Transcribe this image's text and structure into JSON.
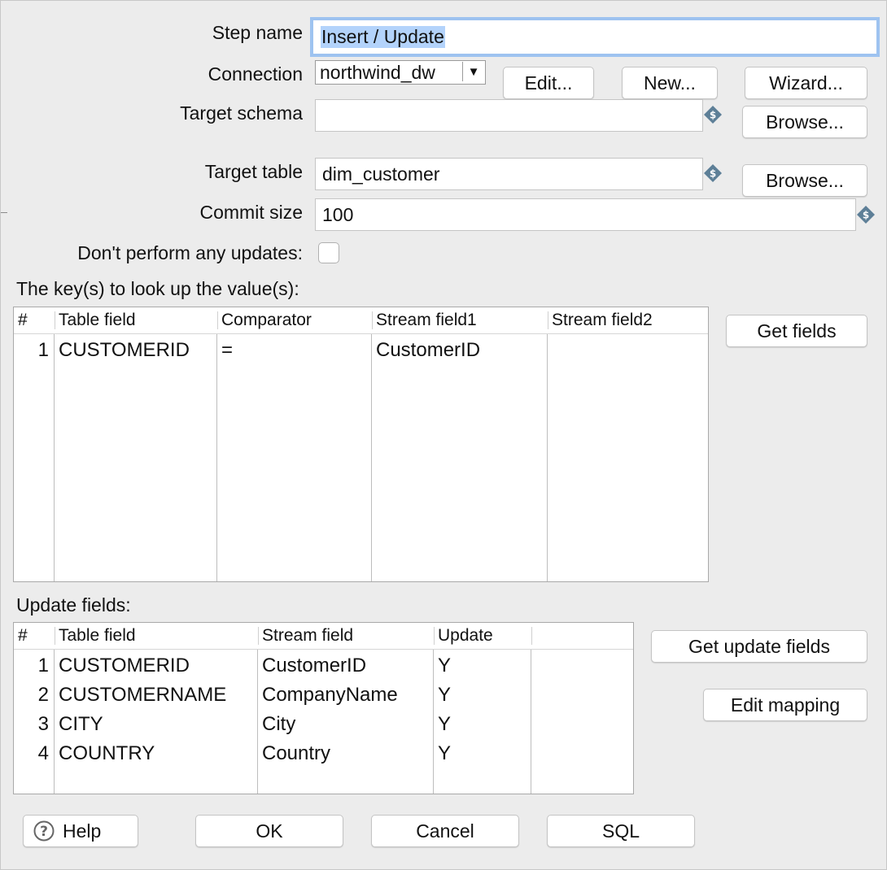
{
  "form": {
    "step_name_label": "Step name",
    "step_name_value": "Insert / Update",
    "connection_label": "Connection",
    "connection_value": "northwind_dw",
    "connection_arrow": "▼",
    "edit_button": "Edit...",
    "new_button": "New...",
    "wizard_button": "Wizard...",
    "target_schema_label": "Target schema",
    "target_schema_value": "",
    "browse_schema_button": "Browse...",
    "target_table_label": "Target table",
    "target_table_value": "dim_customer",
    "browse_table_button": "Browse...",
    "commit_size_label": "Commit size",
    "commit_size_value": "100",
    "no_updates_label": "Don't perform any updates:",
    "no_updates_checked": false,
    "variable_icon_glyph": "$"
  },
  "keys": {
    "title": "The key(s) to look up the value(s):",
    "get_fields_button": "Get fields",
    "headers": [
      "#",
      "Table field",
      "Comparator",
      "Stream field1",
      "Stream field2"
    ],
    "rows": [
      {
        "num": "1",
        "table_field": "CUSTOMERID",
        "comparator": "=",
        "stream_field1": "CustomerID",
        "stream_field2": ""
      }
    ]
  },
  "update": {
    "title": "Update fields:",
    "get_update_fields_button": "Get update fields",
    "edit_mapping_button": "Edit mapping",
    "headers": [
      "#",
      "Table field",
      "Stream field",
      "Update"
    ],
    "rows": [
      {
        "num": "1",
        "table_field": "CUSTOMERID",
        "stream_field": "CustomerID",
        "update": "Y"
      },
      {
        "num": "2",
        "table_field": "CUSTOMERNAME",
        "stream_field": "CompanyName",
        "update": "Y"
      },
      {
        "num": "3",
        "table_field": "CITY",
        "stream_field": "City",
        "update": "Y"
      },
      {
        "num": "4",
        "table_field": "COUNTRY",
        "stream_field": "Country",
        "update": "Y"
      }
    ]
  },
  "footer": {
    "help_button": "Help",
    "help_icon_glyph": "?",
    "ok_button": "OK",
    "cancel_button": "Cancel",
    "sql_button": "SQL"
  },
  "colors": {
    "focus_ring": "#9ec3f0",
    "selection": "#b3d3fb",
    "variable_icon": "#5d7f97"
  }
}
